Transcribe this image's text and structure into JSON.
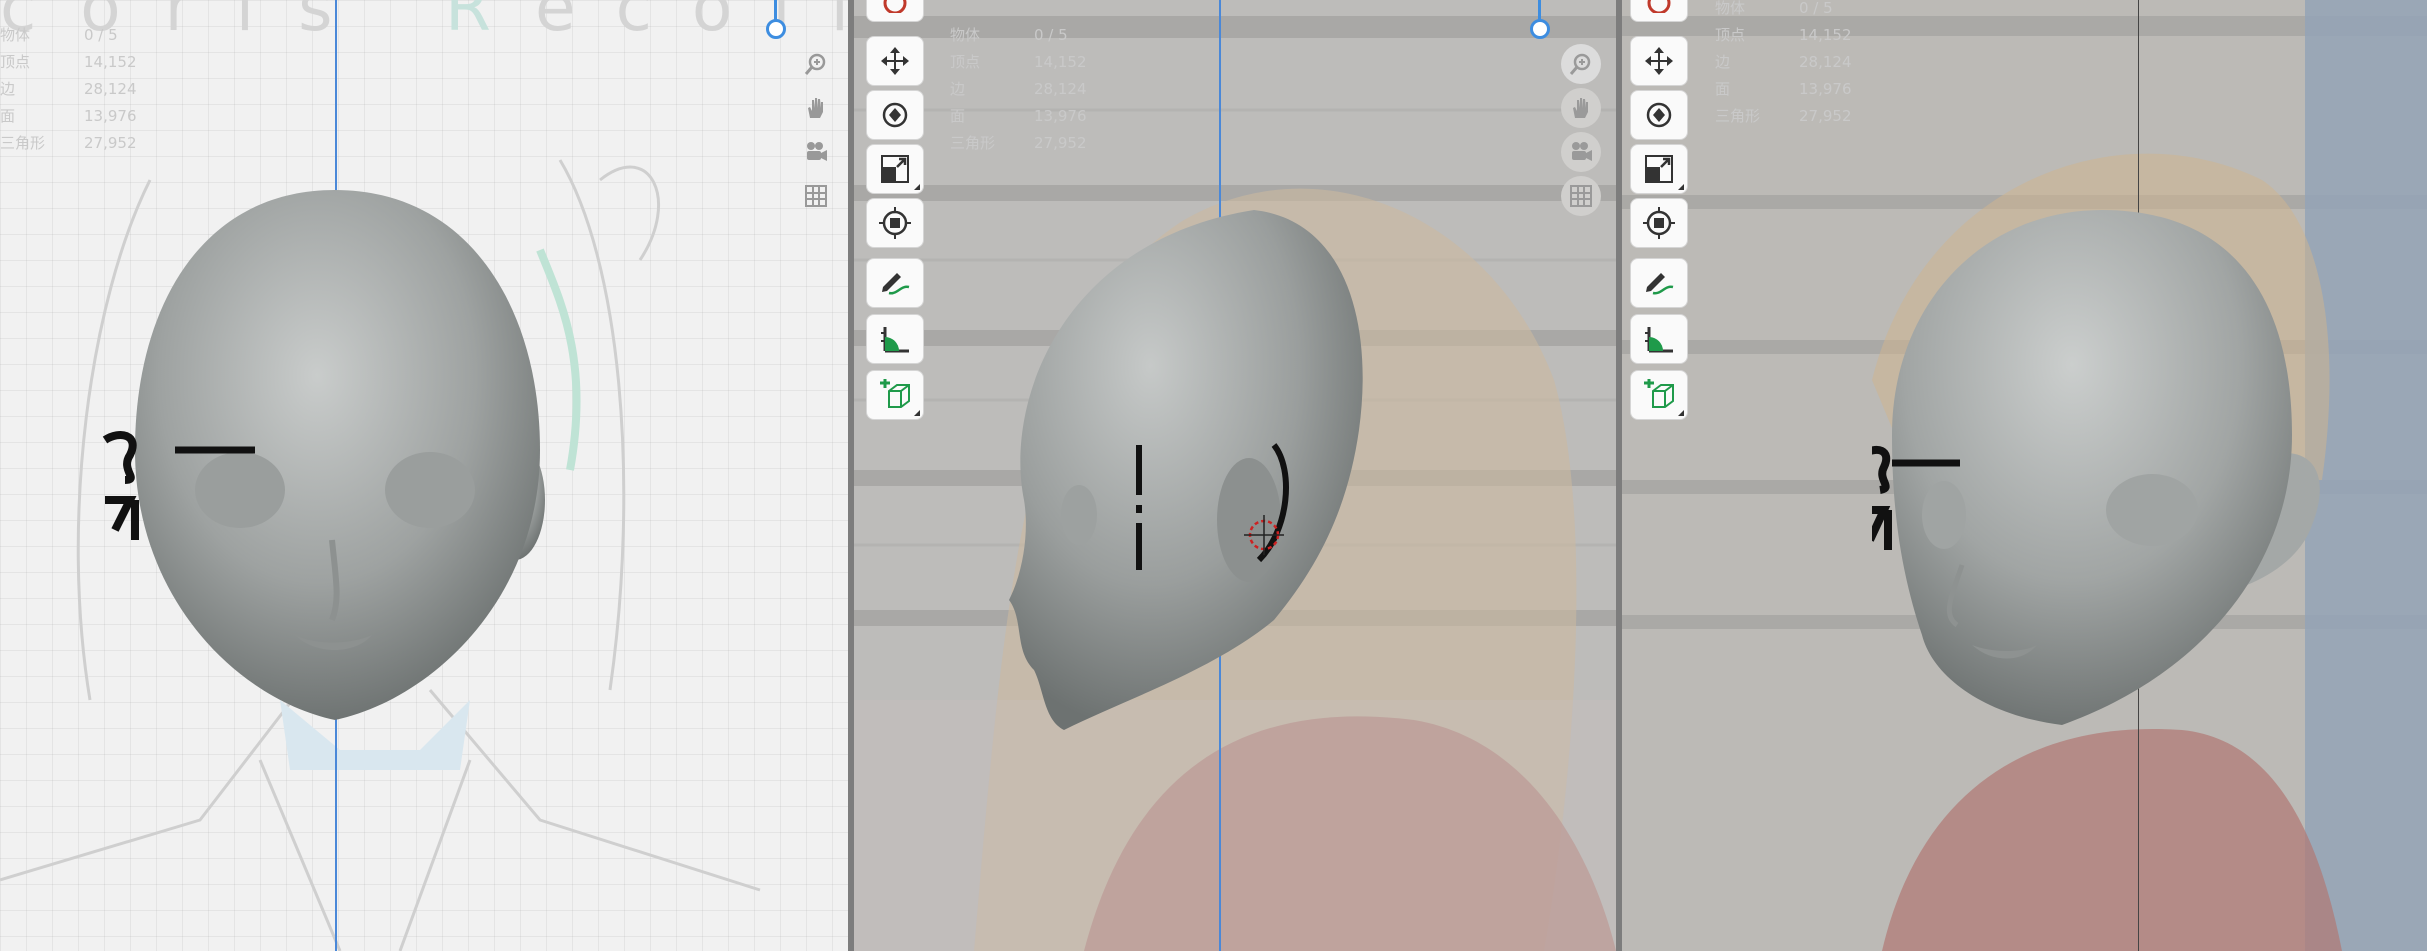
{
  "scene_stats": {
    "objects_label": "物体",
    "objects_value": "0 / 5",
    "vertices_label": "顶点",
    "vertices_value": "14,152",
    "edges_label": "边",
    "edges_value": "28,124",
    "faces_label": "面",
    "faces_value": "13,976",
    "tris_label": "三角形",
    "tris_value": "27,952"
  },
  "viewports": [
    {
      "name": "front-view"
    },
    {
      "name": "side-view"
    },
    {
      "name": "three-quarter-view"
    }
  ],
  "tools": [
    "transform-tool",
    "move-tool",
    "rotate-tool",
    "scale-tool",
    "snap-tool",
    "annotate-tool",
    "measure-tool",
    "add-object-tool"
  ],
  "navigation": [
    "zoom-tool",
    "pan-tool",
    "camera-tool",
    "grid-toggle"
  ],
  "colors": {
    "accent": "#3d8de0",
    "tool_green": "#1f9a4a",
    "head_gray": "#a8acab"
  },
  "reference_text": "coris Recoil"
}
